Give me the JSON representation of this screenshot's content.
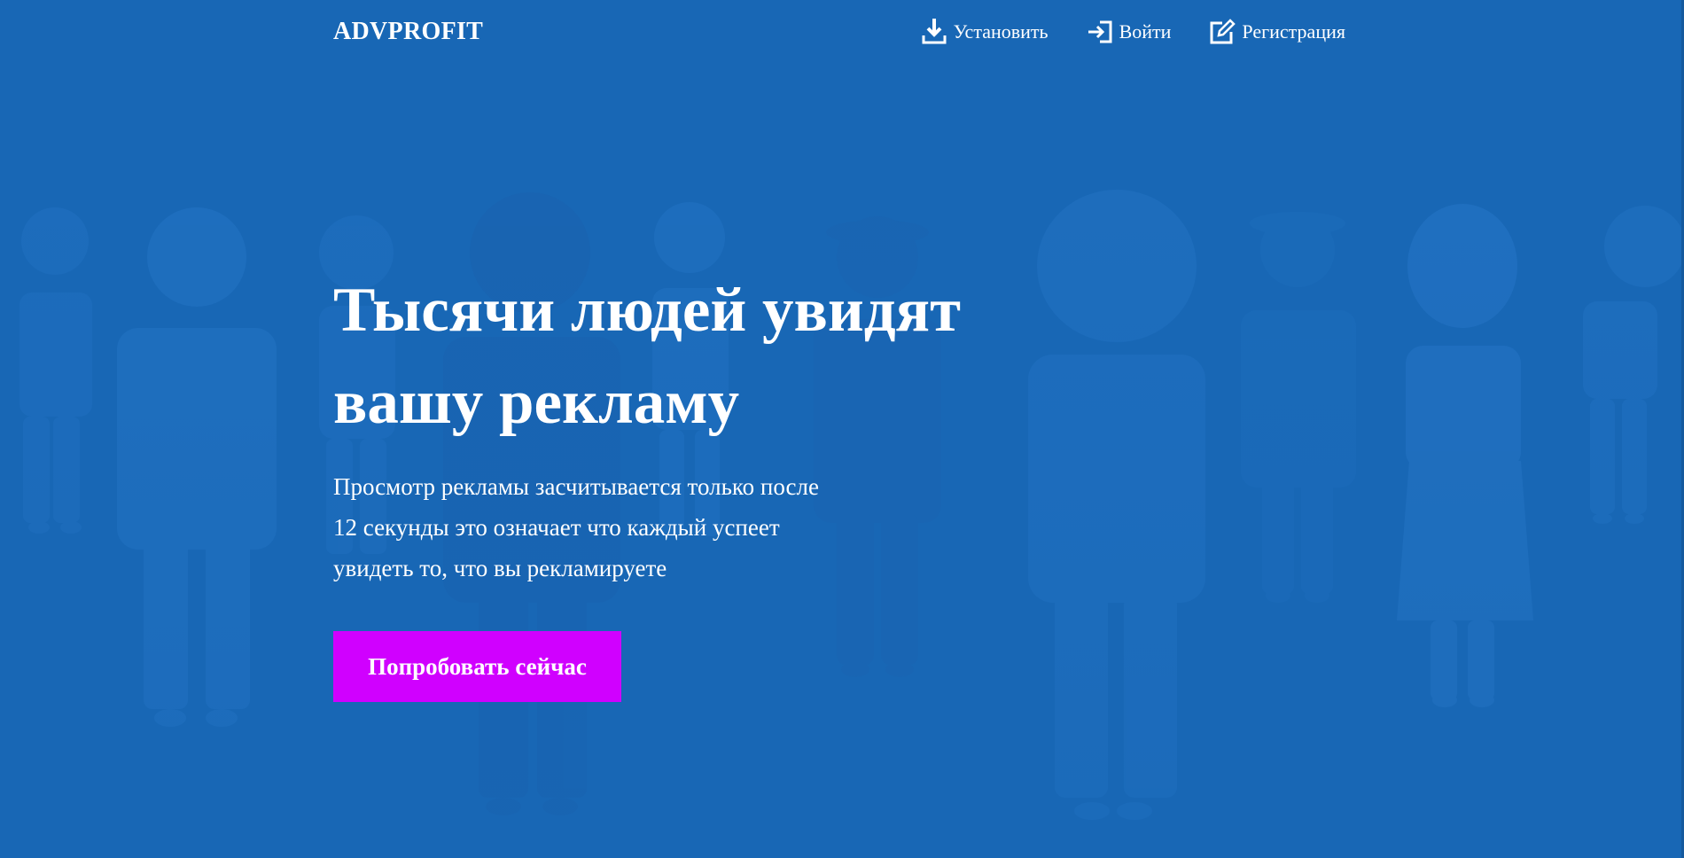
{
  "header": {
    "logo": "ADVPROFIT",
    "nav": {
      "install_label": "Установить",
      "install_icon": "download-icon",
      "login_label": "Войти",
      "login_icon": "sign-in-icon",
      "register_label": "Регистрация",
      "register_icon": "edit-icon"
    }
  },
  "hero": {
    "headline_line1": "Тысячи людей увидят",
    "headline_line2": "вашу рекламу",
    "description_line1": "Просмотр рекламы засчитывается только после",
    "description_line2": "12 секунды это означает что каждый успеет",
    "description_line3": "увидеть то, что вы рекламируете",
    "cta_label": "Попробовать сейчас"
  },
  "colors": {
    "background": "#1b66b2",
    "cta": "#d000ff",
    "text": "#ffffff"
  }
}
